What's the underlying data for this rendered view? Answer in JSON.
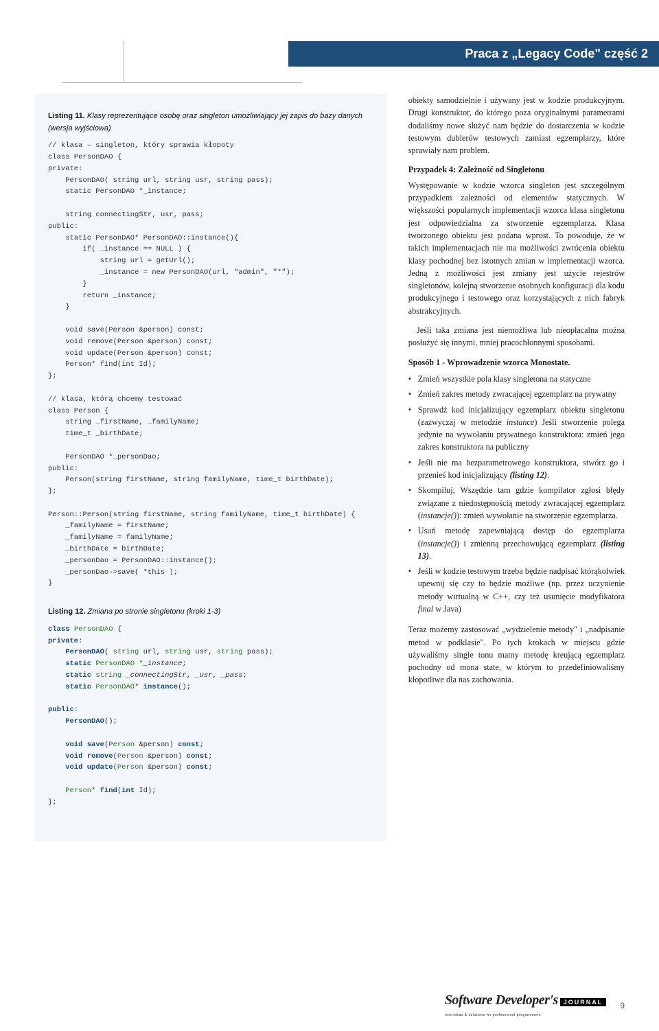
{
  "header": {
    "title": "Praca z „Legacy Code\" część 2"
  },
  "left": {
    "listing11": {
      "label_prefix": "Listing 11.",
      "label_text": "Klasy reprezentujące osobę oraz singleton umożliwiający jej zapis do bazy danych (wersja wyjściowa)",
      "code": "// klasa – singleton, który sprawia kłopoty\nclass PersonDAO {\nprivate:\n    PersonDAO( string url, string usr, string pass);\n    static PersonDAO *_instance;\n\n    string connectingStr, usr, pass;\npublic:\n    static PersonDAO* PersonDAO::instance(){\n        if( _instance == NULL ) {\n            string url = getUrl();\n            _instance = new PersonDAO(url, \"admin\", \"*\");\n        }\n        return _instance;\n    }\n\n    void save(Person &person) const;\n    void remove(Person &person) const;\n    void update(Person &person) const;\n    Person* find(int Id);\n};\n\n// klasa, którą chcemy testować\nclass Person {\n    string _firstName, _familyName;\n    time_t _birthDate;\n\n    PersonDAO *_personDao;\npublic:\n    Person(string firstName, string familyName, time_t birthDate);\n};\n\nPerson::Person(string firstName, string familyName, time_t birthDate) {\n    _familyName = firstName;\n    _familyName = familyName;\n    _birthDate = birthDate;\n    _personDao = PersonDAO::instance();\n    _personDao->save( *this );\n}"
    },
    "listing12": {
      "label_prefix": "Listing 12.",
      "label_text": "Zmiana po stronie singletonu (kroki 1-3)"
    }
  },
  "right": {
    "p1_a": "obiekty samodzielnie i używany jest w kodzie produkcyjnym. Drugi konstruktor, do którego poza oryginalnymi parametrami dodaliśmy nowe służyć nam będzie do dostarczenia w kodzie testowym dublerów testowych zamiast egzemplarzy, które sprawiały nam problem.",
    "case4_title": "Przypadek 4: Zależność od Singletonu",
    "p2": "Występowanie w kodzie wzorca singleton jest szczególnym przypadkiem zależności od elementów statycznych. W większości popularnych implementacji wzorca klasa singletonu jest odpowiedzialna za stworzenie egzemplarza. Klasa tworzonego obiektu jest podana wprost. To powoduje, że w takich implementacjach nie ma możliwości zwrócenia obiektu klasy pochodnej bez istotnych zmian w implementacji wzorca. Jedną z możliwości jest zmiany jest użycie rejestrów singletonów, kolejną stworzenie osobnych konfiguracji dla kodu produkcyjnego i testowego oraz korzystających z nich fabryk abstrakcyjnych.",
    "p3": "Jeśli taka zmiana jest niemożliwa lub nieopłacalna można posłużyć się innymi, mniej pracochłonnymi sposobami.",
    "method1_title": "Sposób 1 - Wprowadzenie wzorca Monostate.",
    "bullets": {
      "b1": "Zmień wszystkie pola klasy singletona na statyczne",
      "b2": "Zmień zakres metody zwracającej egzemplarz na prywatny",
      "b6": "Skompiluj; Wszędzie tam gdzie kompilator zgłosi błędy związane z niedostępnością metody zwracającej egzemplarz ("
    },
    "p_after_a": "Teraz możemy zastosować „wydzielenie metody\" i „nadpisanie metod w podklasie\". Po tych krokach w miejscu gdzie używaliśmy single tonu mamy metodę kreującą egzemplarz pochodny od mona state, w którym to przedefiniowaliśmy kłopotliwe dla nas zachowania."
  },
  "footer": {
    "brand": "Software Developer's",
    "sub": "new ideas & solutions for professional programmers",
    "journal": "JOURNAL",
    "page": "9"
  }
}
